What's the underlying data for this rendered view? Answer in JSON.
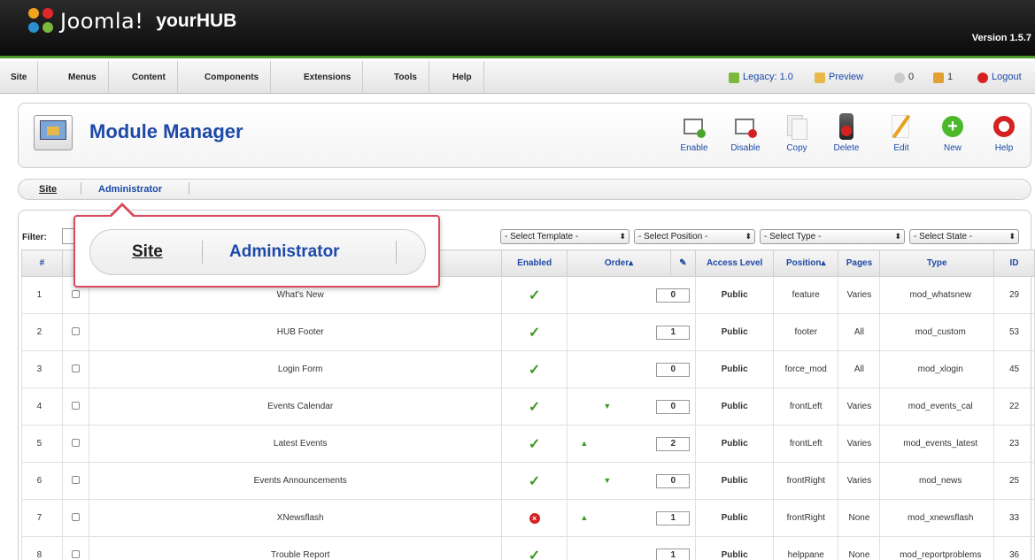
{
  "header": {
    "brand": "Joomla!",
    "site_name": "yourHUB",
    "version": "Version 1.5.7"
  },
  "menu": {
    "items": [
      "Site",
      "Menus",
      "Content",
      "Components",
      "Extensions",
      "Tools",
      "Help"
    ]
  },
  "status": {
    "legacy": "Legacy: 1.0",
    "preview": "Preview",
    "messages": "0",
    "users": "1",
    "logout": "Logout"
  },
  "toolbar": {
    "title": "Module Manager",
    "buttons": [
      "Enable",
      "Disable",
      "Copy",
      "Delete",
      "Edit",
      "New",
      "Help"
    ]
  },
  "submenu": {
    "site": "Site",
    "administrator": "Administrator"
  },
  "filters": {
    "label": "Filter:",
    "template": "- Select Template -",
    "position": "- Select Position -",
    "type": "- Select Type -",
    "state": "- Select State -"
  },
  "table": {
    "headers": {
      "num": "#",
      "enabled": "Enabled",
      "order": "Order▴",
      "access": "Access Level",
      "position": "Position▴",
      "pages": "Pages",
      "type": "Type",
      "id": "ID"
    },
    "rows": [
      {
        "num": "1",
        "name": "What's New",
        "enabled": true,
        "order": "0",
        "up": false,
        "down": false,
        "access": "Public",
        "position": "feature",
        "pages": "Varies",
        "type": "mod_whatsnew",
        "id": "29"
      },
      {
        "num": "2",
        "name": "HUB Footer",
        "enabled": true,
        "order": "1",
        "up": false,
        "down": false,
        "access": "Public",
        "position": "footer",
        "pages": "All",
        "type": "mod_custom",
        "id": "53"
      },
      {
        "num": "3",
        "name": "Login Form",
        "enabled": true,
        "order": "0",
        "up": false,
        "down": false,
        "access": "Public",
        "position": "force_mod",
        "pages": "All",
        "type": "mod_xlogin",
        "id": "45"
      },
      {
        "num": "4",
        "name": "Events Calendar",
        "enabled": true,
        "order": "0",
        "up": false,
        "down": true,
        "access": "Public",
        "position": "frontLeft",
        "pages": "Varies",
        "type": "mod_events_cal",
        "id": "22"
      },
      {
        "num": "5",
        "name": "Latest Events",
        "enabled": true,
        "order": "2",
        "up": true,
        "down": false,
        "access": "Public",
        "position": "frontLeft",
        "pages": "Varies",
        "type": "mod_events_latest",
        "id": "23"
      },
      {
        "num": "6",
        "name": "Events Announcements",
        "enabled": true,
        "order": "0",
        "up": false,
        "down": true,
        "access": "Public",
        "position": "frontRight",
        "pages": "Varies",
        "type": "mod_news",
        "id": "25"
      },
      {
        "num": "7",
        "name": "XNewsflash",
        "enabled": false,
        "order": "1",
        "up": true,
        "down": false,
        "access": "Public",
        "position": "frontRight",
        "pages": "None",
        "type": "mod_xnewsflash",
        "id": "33"
      },
      {
        "num": "8",
        "name": "Trouble Report",
        "enabled": true,
        "order": "1",
        "up": false,
        "down": false,
        "access": "Public",
        "position": "helppane",
        "pages": "None",
        "type": "mod_reportproblems",
        "id": "36"
      }
    ]
  },
  "callout": {
    "site": "Site",
    "administrator": "Administrator"
  },
  "colors": {
    "link_blue": "#1e49a8",
    "header_green": "#4d9a2a",
    "callout_red": "#d94a5a",
    "access_green": "#2a7a1a"
  }
}
